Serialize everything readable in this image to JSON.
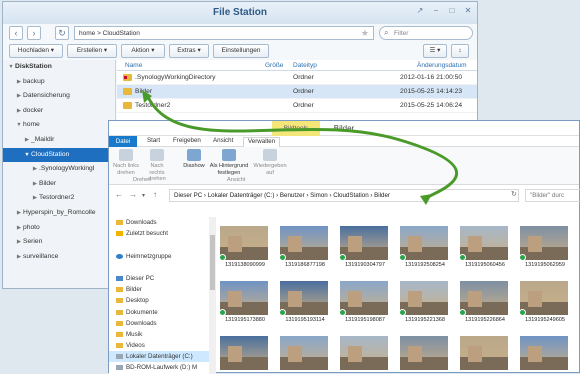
{
  "filestation": {
    "title": "File Station",
    "path": "home > CloudStation",
    "filter_placeholder": "Filter",
    "toolbar": [
      "Hochladen ▾",
      "Erstellen ▾",
      "Aktion ▾",
      "Extras ▾",
      "Einstellungen"
    ],
    "tree": [
      {
        "label": "DiskStation",
        "level": 0,
        "open": true
      },
      {
        "label": "backup",
        "level": 1
      },
      {
        "label": "Datensicherung",
        "level": 1
      },
      {
        "label": "docker",
        "level": 1
      },
      {
        "label": "home",
        "level": 1,
        "open": true
      },
      {
        "label": "_Maildir",
        "level": 2
      },
      {
        "label": "CloudStation",
        "level": 2,
        "open": true,
        "selected": true
      },
      {
        "label": ".SynologyWorkingI",
        "level": 3
      },
      {
        "label": "Bilder",
        "level": 3
      },
      {
        "label": "Testordner2",
        "level": 3
      },
      {
        "label": "Hyperspin_by_Romcolle",
        "level": 1
      },
      {
        "label": "photo",
        "level": 1
      },
      {
        "label": "Serien",
        "level": 1
      },
      {
        "label": "surveillance",
        "level": 1
      }
    ],
    "columns": {
      "name": "Name",
      "size": "Größe",
      "type": "Dateityp",
      "date": "Änderungsdatum"
    },
    "rows": [
      {
        "name": ".SynologyWorkingDirectory",
        "size": "",
        "type": "Ordner",
        "date": "2012-01-16 21:00:50",
        "lock": true
      },
      {
        "name": "Bilder",
        "size": "",
        "type": "Ordner",
        "date": "2015-05-25 14:14:23",
        "selected": true
      },
      {
        "name": "Testordner2",
        "size": "",
        "type": "Ordner",
        "date": "2015-05-25 14:06:24"
      }
    ]
  },
  "explorer": {
    "title": "Bilder",
    "tools_tab": "Bildtools",
    "tabs": [
      "Datei",
      "Start",
      "Freigeben",
      "Ansicht",
      "Verwalten"
    ],
    "ribbon": {
      "rotate_left": "Nach links drehen",
      "rotate_right": "Nach rechts drehen",
      "group_rotate": "Drehen",
      "slideshow": "Diashow",
      "set_background": "Als Hintergrund festlegen",
      "play_to": "Wiedergeben auf",
      "group_view": "Ansicht"
    },
    "breadcrumb": "Dieser PC  ›  Lokaler Datenträger (C:)  ›  Benutzer  ›  Simon  ›  CloudStation  ›  Bilder",
    "search_placeholder": "\"Bilder\" durc",
    "sidebar": [
      {
        "label": "Downloads",
        "icon": "folder-icon"
      },
      {
        "label": "Zuletzt besucht",
        "icon": "star-icon"
      },
      {
        "label": "",
        "icon": ""
      },
      {
        "label": "Heimnetzgruppe",
        "icon": "network-icon"
      },
      {
        "label": "",
        "icon": ""
      },
      {
        "label": "Dieser PC",
        "icon": "pc-icon"
      },
      {
        "label": "Bilder",
        "icon": "folder-icon"
      },
      {
        "label": "Desktop",
        "icon": "folder-icon"
      },
      {
        "label": "Dokumente",
        "icon": "folder-icon"
      },
      {
        "label": "Downloads",
        "icon": "folder-icon"
      },
      {
        "label": "Musik",
        "icon": "folder-icon"
      },
      {
        "label": "Videos",
        "icon": "folder-icon"
      },
      {
        "label": "Lokaler Datenträger (C:)",
        "icon": "disk-icon",
        "selected": true
      },
      {
        "label": "BD-ROM-Laufwerk (D:) M",
        "icon": "disk-icon"
      }
    ],
    "thumbnails_row1": [
      "1319138090999",
      "1319186877198",
      "1319190304797",
      "1319192508254",
      "1319195060456",
      "1319195062959"
    ],
    "thumbnails_row2": [
      "1319195173880",
      "1319195193114",
      "1319195198087",
      "1319195221368",
      "1319195226864",
      "1319195249605"
    ],
    "thumbnails_row3": [
      "",
      "",
      "",
      "",
      "",
      ""
    ]
  }
}
